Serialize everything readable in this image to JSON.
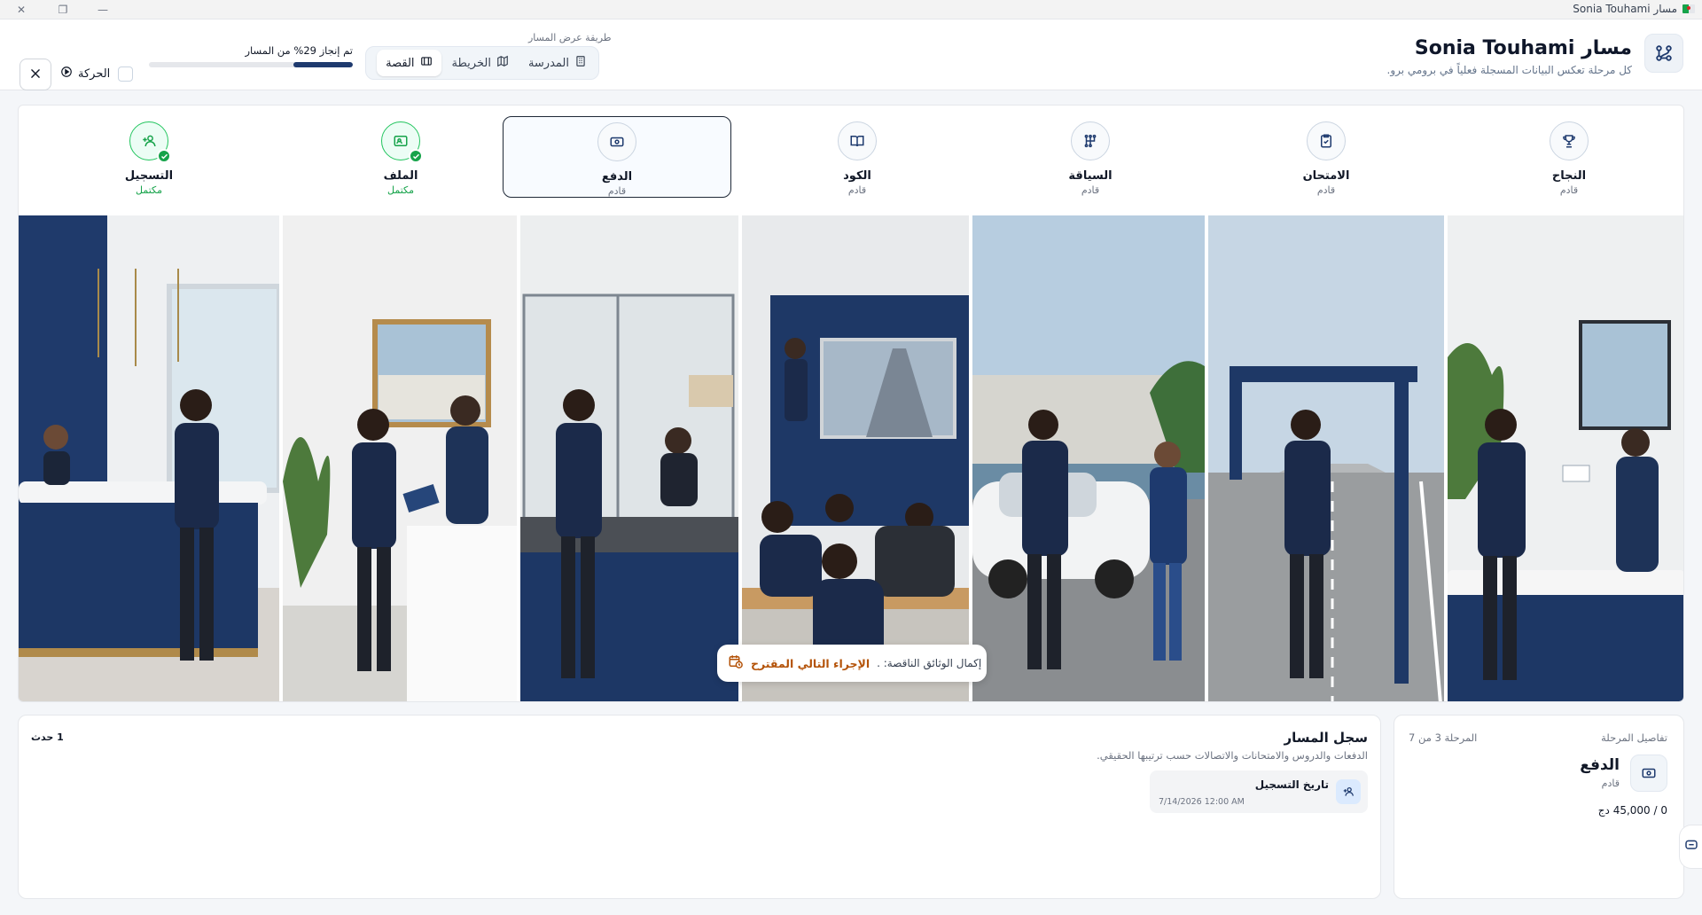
{
  "app": {
    "window_title": "Sonia Touhami مسار"
  },
  "header": {
    "title": "مسار Sonia Touhami",
    "subtitle": "كل مرحلة تعكس البيانات المسجلة فعلياً في برومي برو."
  },
  "view_mode": {
    "label": "طريقة عرض المسار",
    "options": [
      {
        "label": "المدرسة",
        "icon": "building-icon",
        "active": false
      },
      {
        "label": "الخريطة",
        "icon": "map-icon",
        "active": false
      },
      {
        "label": "القصة",
        "icon": "film-icon",
        "active": true
      }
    ]
  },
  "progress": {
    "label": "تم إنجاز 29% من المسار",
    "percent": 29
  },
  "motion": {
    "label": "الحركة",
    "checked": false
  },
  "stages": [
    {
      "title": "النجاح",
      "status": "قادم",
      "icon": "trophy-icon",
      "done": false,
      "current": false
    },
    {
      "title": "الامتحان",
      "status": "قادم",
      "icon": "clipboard-check-icon",
      "done": false,
      "current": false
    },
    {
      "title": "السياقة",
      "status": "قادم",
      "icon": "gear-shift-icon",
      "done": false,
      "current": false
    },
    {
      "title": "الكود",
      "status": "قادم",
      "icon": "book-open-icon",
      "done": false,
      "current": false
    },
    {
      "title": "الدفع",
      "status": "قادم",
      "icon": "cash-icon",
      "done": false,
      "current": true
    },
    {
      "title": "الملف",
      "status": "مكتمل",
      "icon": "folder-user-icon",
      "done": true,
      "current": false
    },
    {
      "title": "التسجيل",
      "status": "مكتمل",
      "icon": "user-plus-icon",
      "done": true,
      "current": false
    }
  ],
  "next_action": {
    "label": "الإجراء التالي المقترح",
    "value": "إكمال الوثائق الناقصة: ."
  },
  "stage_details": {
    "label": "تفاصيل المرحلة",
    "counter": "المرحلة 3 من 7",
    "title": "الدفع",
    "status": "قادم",
    "amount": "0 / 45,000 دج"
  },
  "timeline": {
    "title": "سجل المسار",
    "subtitle": "الدفعات والدروس والامتحانات والاتصالات حسب ترتيبها الحقيقي.",
    "count": "1 حدث",
    "events": [
      {
        "title": "تاريخ التسجيل",
        "date": "7/14/2026 12:00 AM",
        "icon": "user-plus-icon"
      }
    ]
  },
  "colors": {
    "brand_navy": "#1e3a6e",
    "success": "#16a34a",
    "warning": "#b45309",
    "border": "#e5e7eb"
  }
}
